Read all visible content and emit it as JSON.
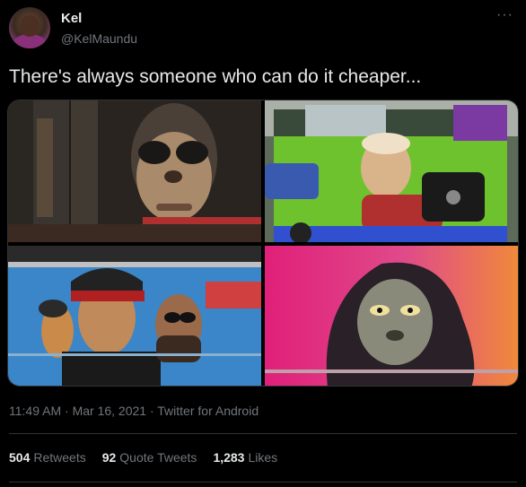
{
  "author": {
    "name": "Kel",
    "handle": "@KelMaundu"
  },
  "tweet": {
    "text": "There's always someone who can do it cheaper..."
  },
  "images": [
    {
      "icon": "bus-mural-sunglasses"
    },
    {
      "icon": "green-matatu-mural"
    },
    {
      "icon": "blue-matatu-rappers-mural"
    },
    {
      "icon": "pink-matatu-portrait-mural"
    }
  ],
  "meta": {
    "time": "11:49 AM",
    "date": "Mar 16, 2021",
    "source": "Twitter for Android",
    "sep": " · "
  },
  "stats": {
    "retweets_count": "504",
    "retweets_label": "Retweets",
    "quotes_count": "92",
    "quotes_label": "Quote Tweets",
    "likes_count": "1,283",
    "likes_label": "Likes"
  },
  "colors": {
    "background": "#000000",
    "text": "#e7e9ea",
    "secondary": "#71767b",
    "border": "#2f3336"
  }
}
